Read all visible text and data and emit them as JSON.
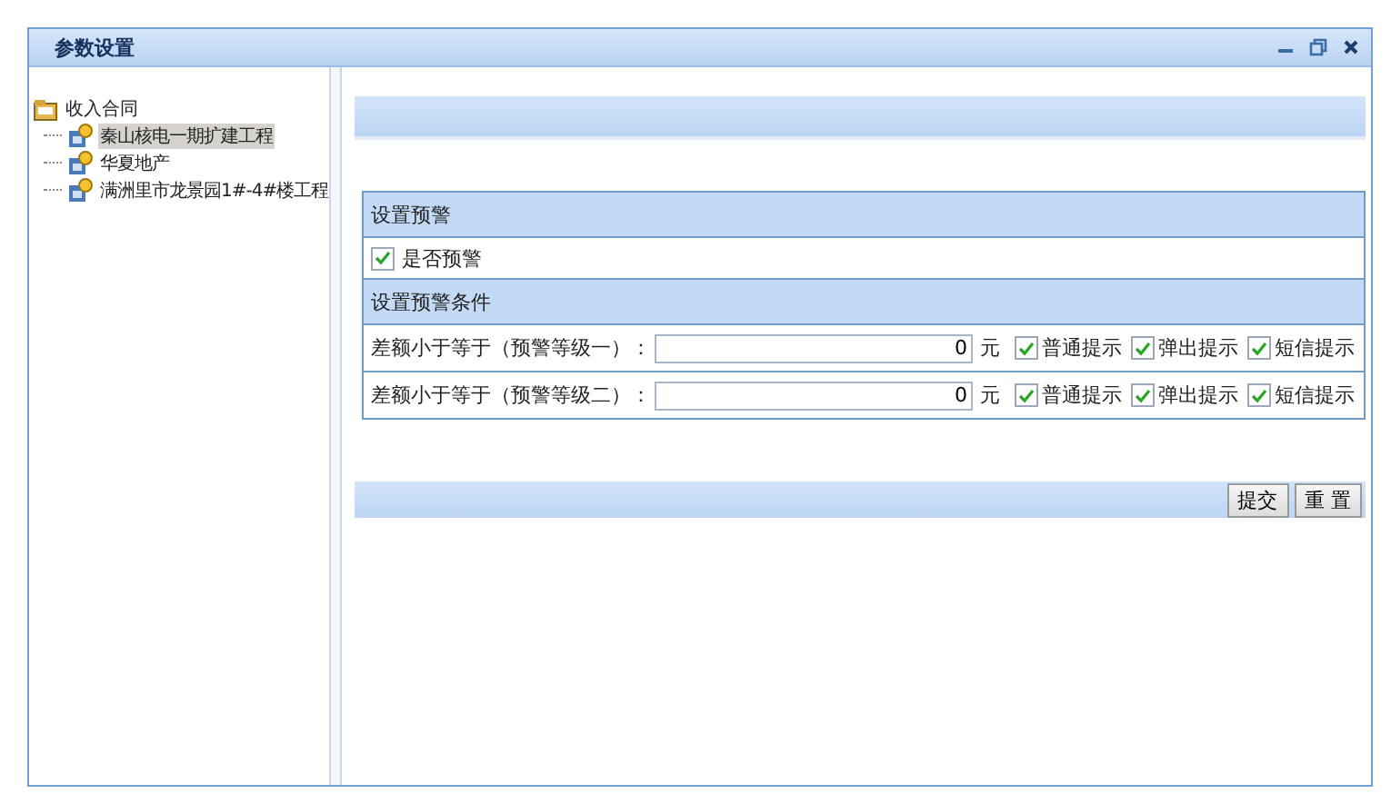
{
  "window": {
    "title": "参数设置"
  },
  "tree": {
    "label": "收入合同",
    "children": [
      {
        "label": "秦山核电一期扩建工程",
        "selected": true
      },
      {
        "label": "华夏地产",
        "selected": false
      },
      {
        "label": "满洲里市龙景园1#-4#楼工程",
        "selected": false
      }
    ]
  },
  "form": {
    "section_title": "设置预警",
    "enable": {
      "label": "是否预警",
      "checked": true
    },
    "conditions_title": "设置预警条件",
    "rows": [
      {
        "label": "差额小于等于（预警等级一）：",
        "value": "0",
        "unit": "元",
        "options": [
          {
            "label": "普通提示",
            "checked": true
          },
          {
            "label": "弹出提示",
            "checked": true
          },
          {
            "label": "短信提示",
            "checked": true
          }
        ]
      },
      {
        "label": "差额小于等于（预警等级二）：",
        "value": "0",
        "unit": "元",
        "options": [
          {
            "label": "普通提示",
            "checked": true
          },
          {
            "label": "弹出提示",
            "checked": true
          },
          {
            "label": "短信提示",
            "checked": true
          }
        ]
      }
    ]
  },
  "buttons": [
    "提交",
    "重 置"
  ]
}
